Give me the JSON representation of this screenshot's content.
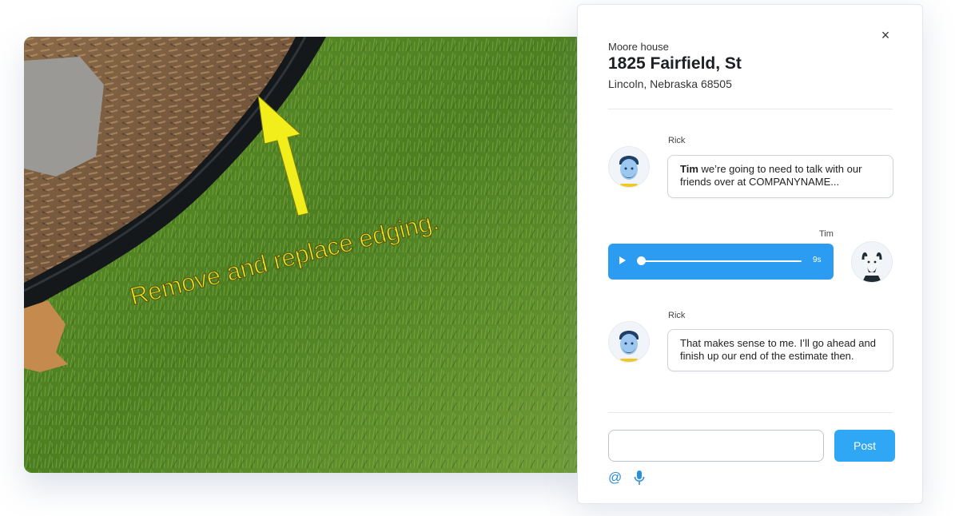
{
  "photo": {
    "annotation_text": "Remove and replace edging.",
    "arrow_color": "#f2ee1c"
  },
  "panel": {
    "label": "Moore house",
    "title": "1825 Fairfield, St",
    "subtitle": "Lincoln, Nebraska 68505",
    "close_icon": "×"
  },
  "messages": [
    {
      "author": "Rick",
      "bold": "Tim",
      "text": " we’re going to need to talk with our friends over at COMPANYNAME..."
    },
    {
      "author": "Tim",
      "type": "audio",
      "duration": "9s",
      "progress": 0
    },
    {
      "author": "Rick",
      "bold": "",
      "text": "That makes sense to me. I’ll go ahead and finish up our end of the estimate then."
    }
  ],
  "composer": {
    "placeholder": "",
    "post_label": "Post",
    "mention_icon": "@"
  },
  "colors": {
    "accent": "#2fa7f5",
    "audio_bg": "#2b9cf2"
  }
}
